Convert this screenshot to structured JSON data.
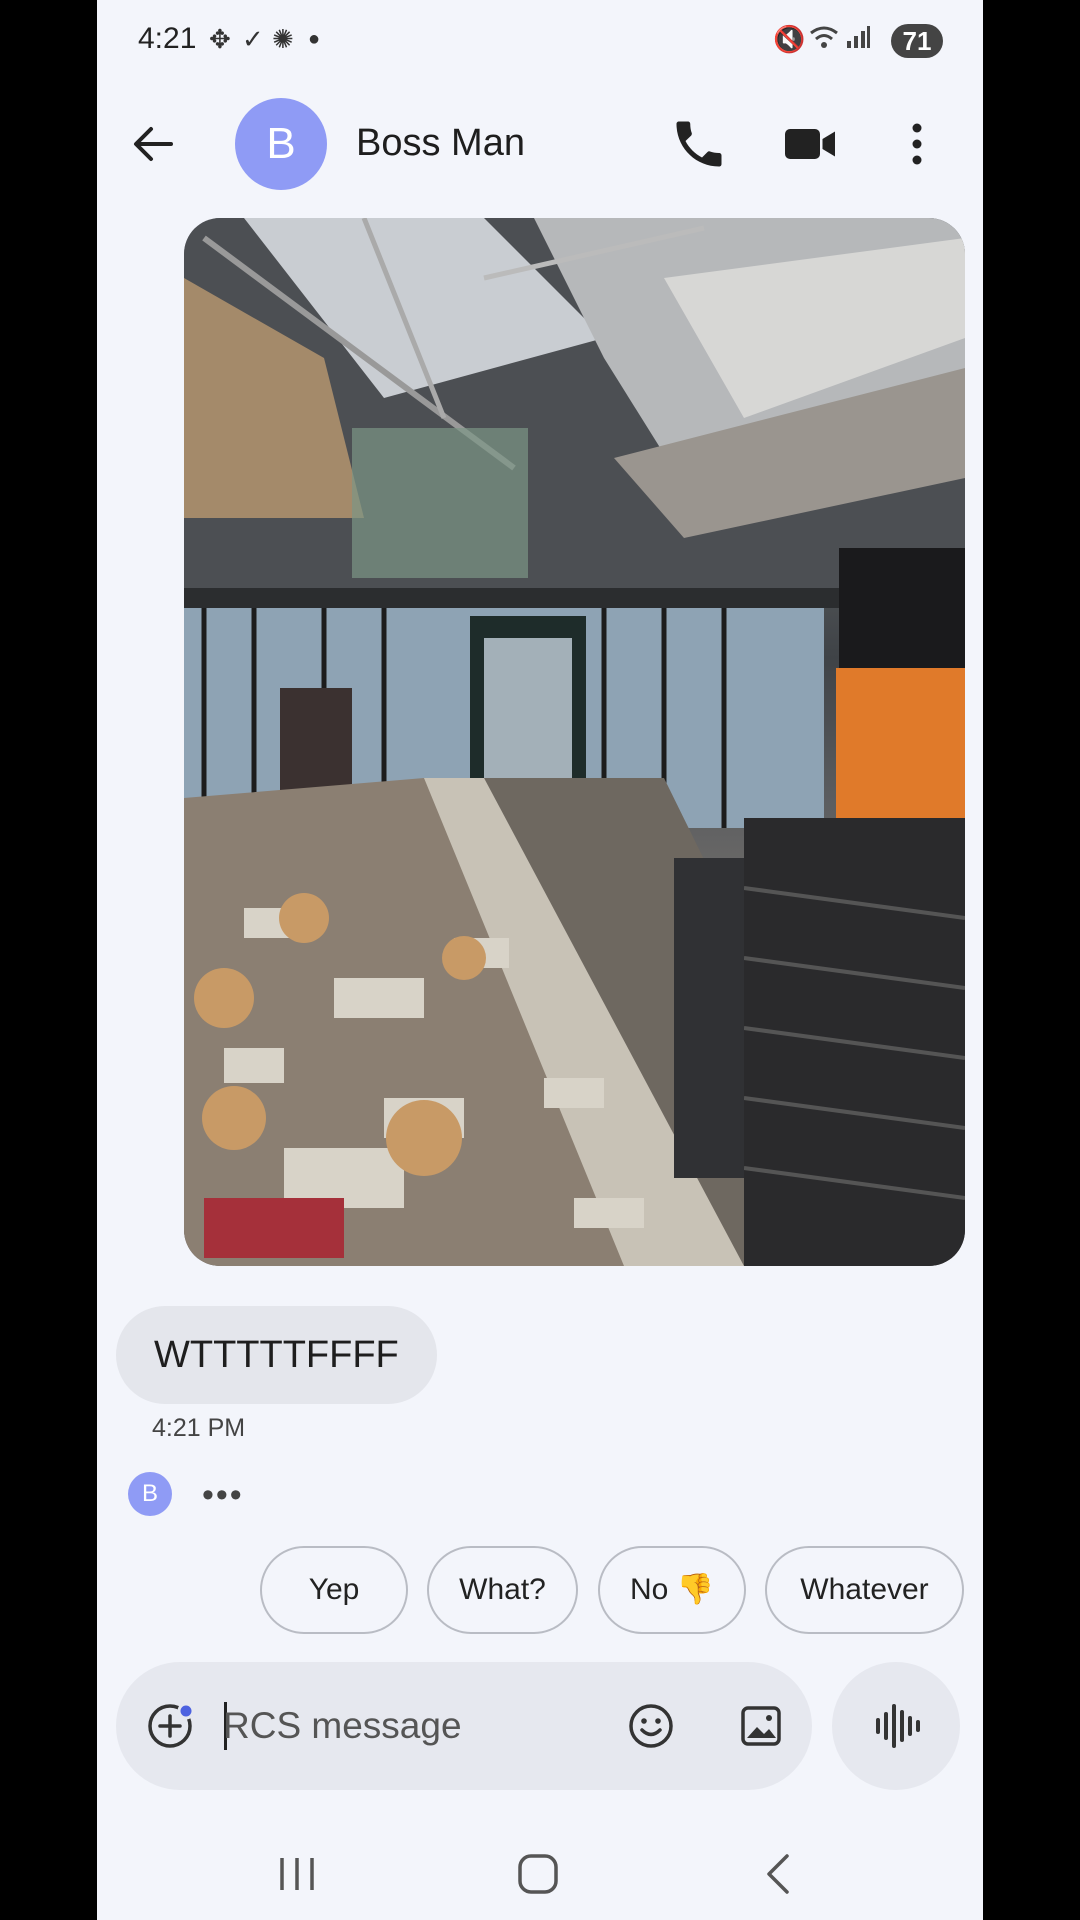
{
  "status_bar": {
    "time": "4:21",
    "battery": "71"
  },
  "header": {
    "avatar_letter": "B",
    "contact_name": "Boss Man"
  },
  "conversation": {
    "message_text": "WTTTTTFFFF",
    "message_time": "4:21 PM",
    "typing_avatar_letter": "B",
    "typing_indicator": "•••"
  },
  "smart_replies": [
    "Yep",
    "What?",
    "No 👎",
    "Whatever"
  ],
  "compose": {
    "placeholder": "RCS message"
  },
  "colors": {
    "avatar": "#8f9bf5",
    "background": "#f3f5fb",
    "bubble": "#e4e6ec"
  }
}
